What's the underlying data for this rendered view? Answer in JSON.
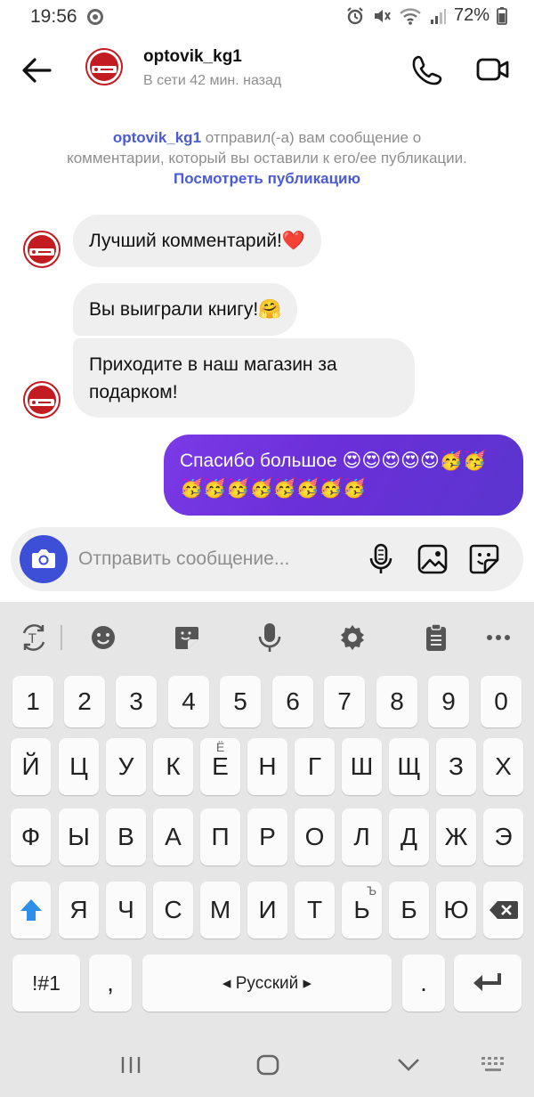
{
  "status_bar": {
    "time": "19:56",
    "battery": "72%"
  },
  "header": {
    "name": "optovik_kg1",
    "status": "В сети 42 мин. назад"
  },
  "notice": {
    "username": "optovik_kg1",
    "text": " отправил(-а) вам сообщение о комментарии, который вы оставили к его/ее публикации. ",
    "link": "Посмотреть публикацию"
  },
  "messages": [
    {
      "from": "them",
      "text": "Лучший комментарий!❤️"
    },
    {
      "from": "them",
      "text": "Вы выиграли книгу!🤗"
    },
    {
      "from": "them",
      "text": "Приходите в наш магазин за подарком!"
    },
    {
      "from": "me",
      "text": "Спасибо большое 😍😍😍😍😍🥳🥳🥳🥳🥳🥳🥳🥳🥳🥳"
    }
  ],
  "composer": {
    "placeholder": "Отправить сообщение..."
  },
  "keyboard": {
    "row_numbers": [
      "1",
      "2",
      "3",
      "4",
      "5",
      "6",
      "7",
      "8",
      "9",
      "0"
    ],
    "row1": [
      "Й",
      "Ц",
      "У",
      "К",
      "Е",
      "Н",
      "Г",
      "Ш",
      "Щ",
      "З",
      "Х"
    ],
    "row1_hint_e": "Ё",
    "row2": [
      "Ф",
      "Ы",
      "В",
      "А",
      "П",
      "Р",
      "О",
      "Л",
      "Д",
      "Ж",
      "Э"
    ],
    "row3": [
      "Я",
      "Ч",
      "С",
      "М",
      "И",
      "Т",
      "Ь",
      "Б",
      "Ю"
    ],
    "row3_hint_soft": "Ъ",
    "symbols_key": "!#1",
    "comma_key": ",",
    "space_label": "◂ Русский ▸",
    "period_key": ".",
    "colors": {
      "shift": "#2f8fe8"
    }
  },
  "icons": {
    "back": "back-arrow-icon",
    "call": "phone-icon",
    "video": "video-camera-icon",
    "camera": "camera-icon",
    "mic": "microphone-icon",
    "gallery": "gallery-icon",
    "sticker": "sticker-icon"
  },
  "colors": {
    "accent": "#4a5bd4",
    "bubble_in": "#efefef",
    "bubble_out_start": "#7b3ae6",
    "bubble_out_end": "#5b35cf",
    "brand_red": "#c21b22"
  }
}
